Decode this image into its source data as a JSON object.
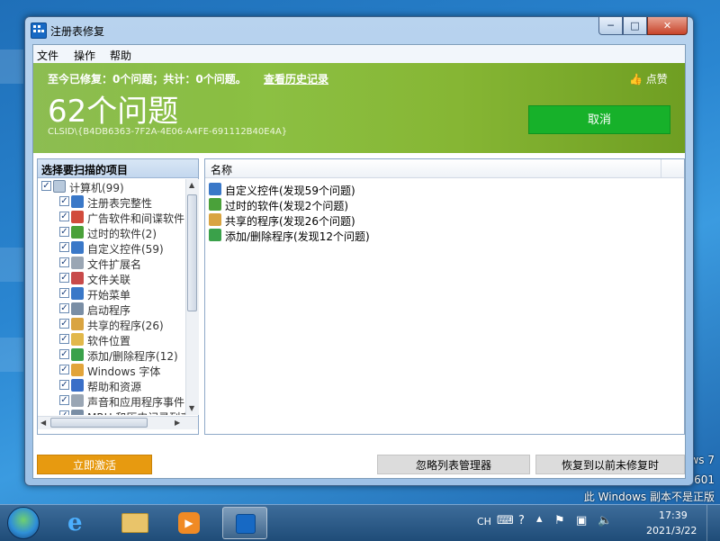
{
  "window": {
    "title": "注册表修复",
    "controls": {
      "minimize": "─",
      "maximize": "□",
      "close": "✕"
    }
  },
  "menu": [
    "文件",
    "操作",
    "帮助"
  ],
  "banner": {
    "summary": "至今已修复：0个问题；共计：0个问题。",
    "history_link": "查看历史记录",
    "like": "点赞",
    "issue_count": "62个问题",
    "clsid": "CLSID\\{B4DB6363-7F2A-4E06-A4FE-691112B40E4A}",
    "cancel": "取消"
  },
  "left_pane": {
    "header": "选择要扫描的项目",
    "root": "计算机(99)",
    "items": [
      {
        "label": "注册表完整性",
        "icon": "registry-icon",
        "color": "#3a78c8"
      },
      {
        "label": "广告软件和间谍软件",
        "icon": "adware-icon",
        "color": "#d14b3c"
      },
      {
        "label": "过时的软件(2)",
        "icon": "trash-icon",
        "color": "#4aa13a"
      },
      {
        "label": "自定义控件(59)",
        "icon": "blocks-icon",
        "color": "#3a78c8"
      },
      {
        "label": "文件扩展名",
        "icon": "document-icon",
        "color": "#9aa6b4"
      },
      {
        "label": "文件关联",
        "icon": "file-association-icon",
        "color": "#c84a4a"
      },
      {
        "label": "开始菜单",
        "icon": "start-menu-icon",
        "color": "#3a78c8"
      },
      {
        "label": "启动程序",
        "icon": "startup-icon",
        "color": "#7a8ea5"
      },
      {
        "label": "共享的程序(26)",
        "icon": "handshake-icon",
        "color": "#d9a441"
      },
      {
        "label": "软件位置",
        "icon": "folder-icon",
        "color": "#e2b84a"
      },
      {
        "label": "添加/删除程序(12)",
        "icon": "recycle-icon",
        "color": "#3aa14a"
      },
      {
        "label": "Windows 字体",
        "icon": "font-icon",
        "color": "#e2a43a"
      },
      {
        "label": "帮助和资源",
        "icon": "help-icon",
        "color": "#3a6fc8"
      },
      {
        "label": "声音和应用程序事件",
        "icon": "sound-icon",
        "color": "#9aa6b4"
      },
      {
        "label": "MRU 和历史记录列表",
        "icon": "history-icon",
        "color": "#7a8ea5"
      }
    ]
  },
  "right_pane": {
    "column": "名称",
    "results": [
      {
        "label": "自定义控件(发现59个问题)",
        "icon": "blocks-icon",
        "color": "#3a78c8"
      },
      {
        "label": "过时的软件(发现2个问题)",
        "icon": "trash-icon",
        "color": "#4aa13a"
      },
      {
        "label": "共享的程序(发现26个问题)",
        "icon": "handshake-icon",
        "color": "#d9a441"
      },
      {
        "label": "添加/删除程序(发现12个问题)",
        "icon": "recycle-icon",
        "color": "#3aa14a"
      }
    ]
  },
  "buttons": {
    "activate": "立即激活",
    "ignore_list": "忽略列表管理器",
    "restore": "恢复到以前未修复时"
  },
  "desktop": {
    "watermark_line1": "ws 7",
    "watermark_line2": "601",
    "watermark_line3": "此 Windows 副本不是正版"
  },
  "taskbar": {
    "language": "CH",
    "time": "17:39",
    "date": "2021/3/22"
  },
  "colors": {
    "banner_green": "#8cc043",
    "cancel_green": "#17b12a",
    "activate_orange": "#e79a10"
  }
}
